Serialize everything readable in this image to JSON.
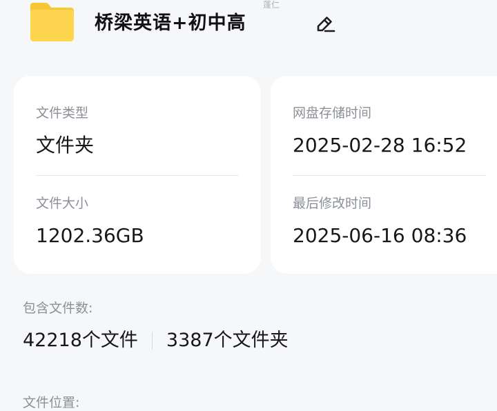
{
  "header": {
    "title": "桥梁英语+初中高",
    "ghost_text": "蓬仁",
    "folder_color": "#fdd147"
  },
  "details": {
    "file_type_label": "文件类型",
    "file_type_value": "文件夹",
    "storage_time_label": "网盘存储时间",
    "storage_time_value": "2025-02-28 16:52",
    "file_size_label": "文件大小",
    "file_size_value": "1202.36GB",
    "modified_time_label": "最后修改时间",
    "modified_time_value": "2025-06-16 08:36"
  },
  "contents": {
    "label": "包含文件数:",
    "files_count": "42218个文件",
    "folders_count": "3387个文件夹"
  },
  "location": {
    "label": "文件位置:"
  },
  "colors": {
    "background": "#f6f7f9",
    "card": "#ffffff",
    "label": "#8a8f98",
    "value": "#17171b"
  }
}
